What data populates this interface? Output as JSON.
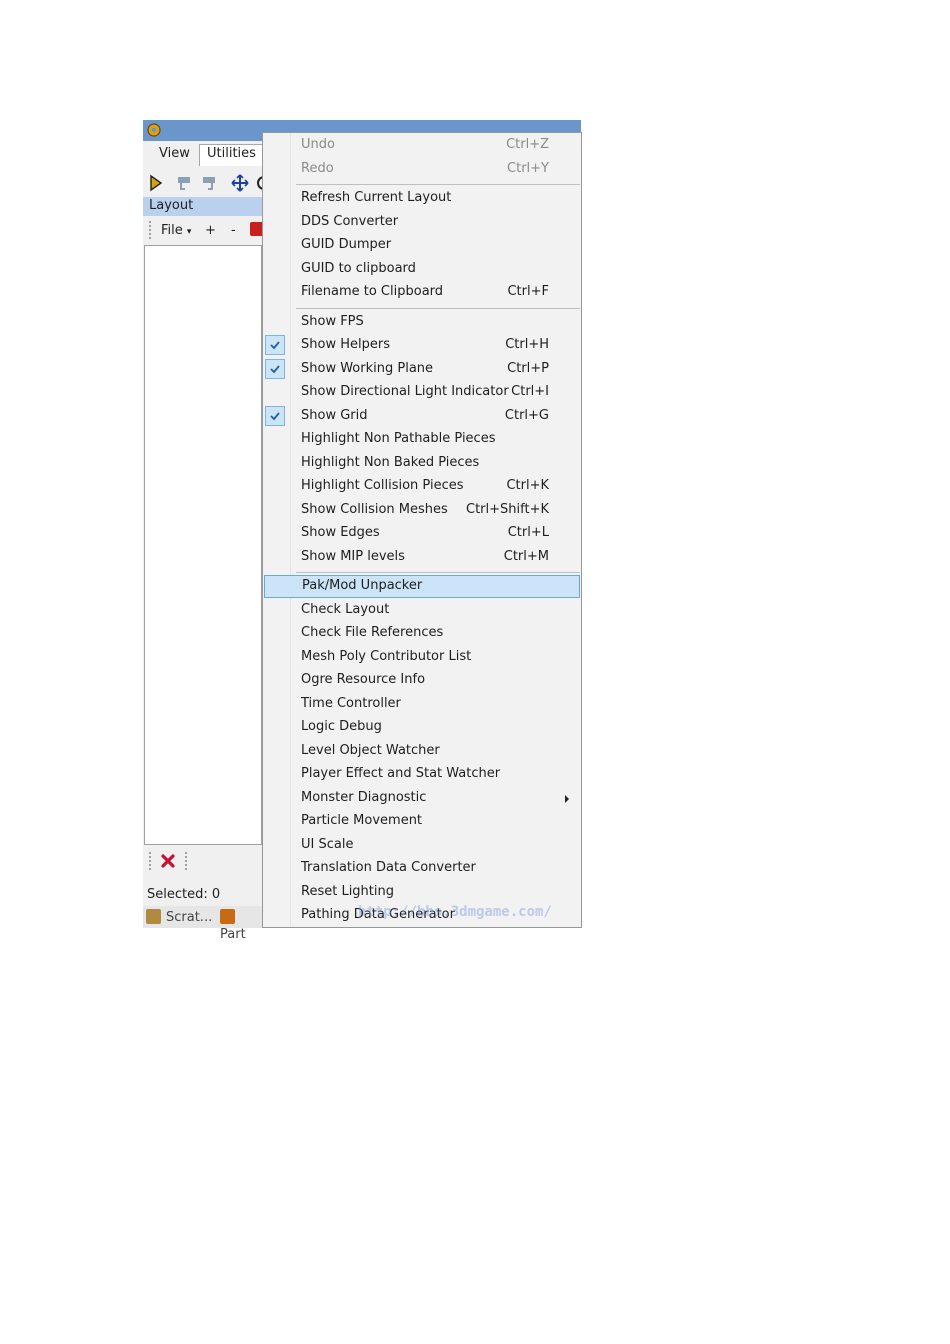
{
  "window": {
    "menubar": {
      "view": "View",
      "utilities": "Utilities"
    },
    "layout_panel": {
      "title": "Layout",
      "file_menu": "File",
      "file_menu_arrow": "▾",
      "add": "+",
      "remove": "-"
    },
    "status": {
      "selected": "Selected: 0"
    },
    "taskbar": {
      "tab1": "Scrat...",
      "tab2": "Part"
    }
  },
  "context_menu": {
    "items": [
      {
        "label": "Undo",
        "shortcut": "Ctrl+Z",
        "disabled": true
      },
      {
        "label": "Redo",
        "shortcut": "Ctrl+Y",
        "disabled": true
      },
      {
        "label": "Refresh Current Layout",
        "shortcut": ""
      },
      {
        "label": "DDS Converter",
        "shortcut": ""
      },
      {
        "label": "GUID Dumper",
        "shortcut": ""
      },
      {
        "label": "GUID to clipboard",
        "shortcut": ""
      },
      {
        "label": "Filename to Clipboard",
        "shortcut": "Ctrl+F"
      },
      {
        "label": "Show FPS",
        "shortcut": ""
      },
      {
        "label": "Show Helpers",
        "shortcut": "Ctrl+H",
        "checked": true
      },
      {
        "label": "Show Working Plane",
        "shortcut": "Ctrl+P",
        "checked": true
      },
      {
        "label": "Show Directional Light Indicator",
        "shortcut": "Ctrl+I"
      },
      {
        "label": "Show Grid",
        "shortcut": "Ctrl+G",
        "checked": true
      },
      {
        "label": "Highlight Non Pathable Pieces",
        "shortcut": ""
      },
      {
        "label": "Highlight Non Baked Pieces",
        "shortcut": ""
      },
      {
        "label": "Highlight Collision Pieces",
        "shortcut": "Ctrl+K"
      },
      {
        "label": "Show Collision Meshes",
        "shortcut": "Ctrl+Shift+K"
      },
      {
        "label": "Show Edges",
        "shortcut": "Ctrl+L"
      },
      {
        "label": "Show MIP levels",
        "shortcut": "Ctrl+M"
      },
      {
        "label": "Pak/Mod Unpacker",
        "shortcut": "",
        "highlighted": true
      },
      {
        "label": "Check Layout",
        "shortcut": ""
      },
      {
        "label": "Check File References",
        "shortcut": ""
      },
      {
        "label": "Mesh Poly Contributor List",
        "shortcut": ""
      },
      {
        "label": "Ogre Resource Info",
        "shortcut": ""
      },
      {
        "label": "Time Controller",
        "shortcut": ""
      },
      {
        "label": "Logic Debug",
        "shortcut": ""
      },
      {
        "label": "Level Object Watcher",
        "shortcut": ""
      },
      {
        "label": "Player Effect and Stat Watcher",
        "shortcut": ""
      },
      {
        "label": "Monster Diagnostic",
        "shortcut": "",
        "submenu": true
      },
      {
        "label": "Particle Movement",
        "shortcut": ""
      },
      {
        "label": "UI Scale",
        "shortcut": ""
      },
      {
        "label": "Translation Data Converter",
        "shortcut": ""
      },
      {
        "label": "Reset Lighting",
        "shortcut": ""
      },
      {
        "label": "Pathing Data Generator",
        "shortcut": ""
      }
    ]
  },
  "watermark": "http://bbs.3dmgame.com/",
  "colors": {
    "titlebar": "#6a96cc",
    "highlight": "#cce4f7",
    "highlight_border": "#6aa6e0",
    "check_icon": "#1f5fa8"
  }
}
